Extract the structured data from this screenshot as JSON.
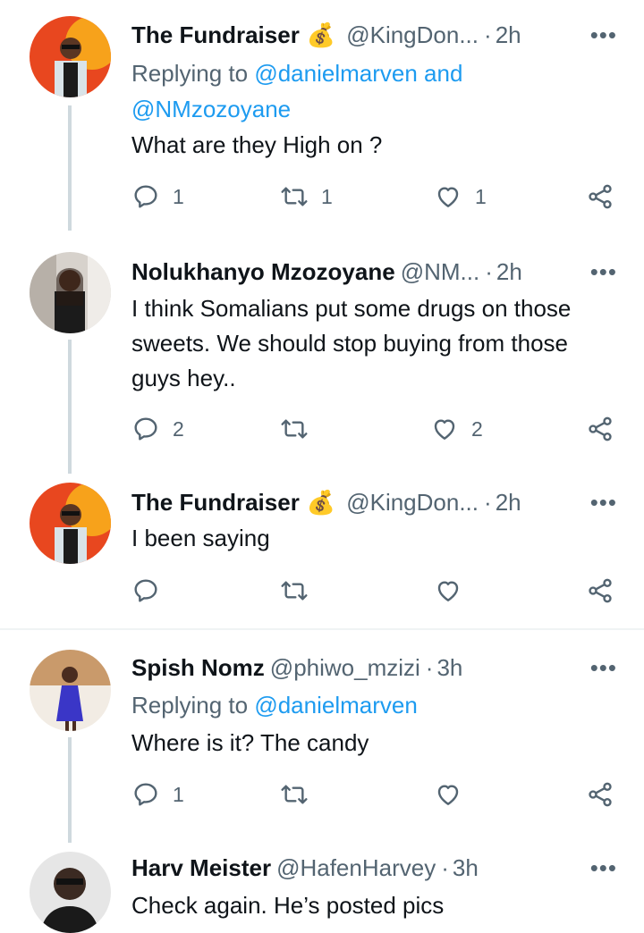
{
  "tweets": [
    {
      "name": "The Fundraiser",
      "emoji": "💰",
      "handle": "@KingDon...",
      "time": "2h",
      "reply_prefix": "Replying to",
      "reply_mentions": "@danielmarven and @NMzozoyane",
      "text": "What are they High on ?",
      "replies": "1",
      "retweets": "1",
      "likes": "1"
    },
    {
      "name": "Nolukhanyo Mzozoyane",
      "handle": "@NM...",
      "time": "2h",
      "text": "I think Somalians put some drugs on those sweets. We should stop buying from those guys hey..",
      "replies": "2",
      "retweets": "",
      "likes": "2"
    },
    {
      "name": "The Fundraiser",
      "emoji": "💰",
      "handle": "@KingDon...",
      "time": "2h",
      "text": "I been saying",
      "replies": "",
      "retweets": "",
      "likes": ""
    },
    {
      "name": "Spish Nomz",
      "handle": "@phiwo_mzizi",
      "time": "3h",
      "reply_prefix": "Replying to",
      "reply_mentions": "@danielmarven",
      "text": "Where is it? The candy",
      "replies": "1",
      "retweets": "",
      "likes": ""
    },
    {
      "name": "Harv Meister",
      "handle": "@HafenHarvey",
      "time": "3h",
      "text": "Check again. He’s posted pics"
    }
  ],
  "ui": {
    "more": "•••",
    "dot": "·"
  },
  "colors": {
    "accent": "#1d9bf0",
    "muted": "#536471",
    "thread_line": "#cfd9de"
  }
}
